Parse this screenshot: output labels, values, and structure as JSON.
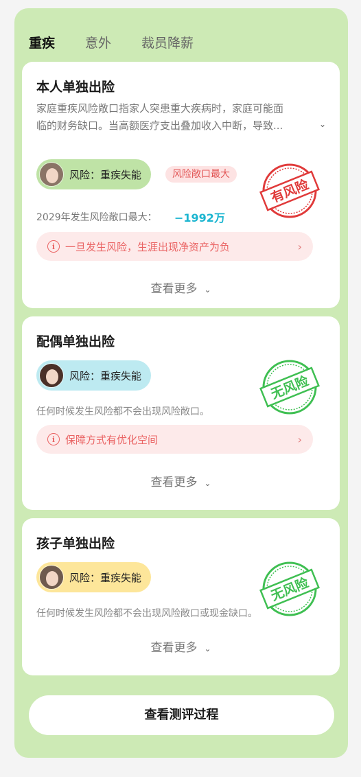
{
  "tabs": [
    {
      "label": "重疾",
      "active": true
    },
    {
      "label": "意外",
      "active": false
    },
    {
      "label": "裁员降薪",
      "active": false
    }
  ],
  "cards": [
    {
      "title": "本人单独出险",
      "description_line1": "家庭重疾风险敞口指家人突患重大疾病时，家庭可能面",
      "description_line2": "临的财务缺口。当高额医疗支出叠加收入中断，导致...",
      "risk_label": "风险：重疾失能",
      "risk_pill_color": "#bfe3a6",
      "tag": "风险敞口最大",
      "stat_text": "2029年发生风险敞口最大：",
      "stat_value": "−1992万",
      "note": "一旦发生风险，生涯出现净资产为负",
      "more": "查看更多",
      "stamp_text": "有风险",
      "stamp_color": "#e03a3a"
    },
    {
      "title": "配偶单独出险",
      "risk_label": "风险：重疾失能",
      "risk_pill_color": "#bdeaf1",
      "line": "任何时候发生风险都不会出现风险敞口。",
      "note": "保障方式有优化空间",
      "more": "查看更多",
      "stamp_text": "无风险",
      "stamp_color": "#3fbf52"
    },
    {
      "title": "孩子单独出险",
      "risk_label": "风险：重疾失能",
      "risk_pill_color": "#fde69a",
      "line": "任何时候发生风险都不会出现风险敞口或现金缺口。",
      "more": "查看更多",
      "stamp_text": "无风险",
      "stamp_color": "#3fbf52"
    }
  ],
  "bottom_button": "查看测评过程",
  "icons": {
    "info": "info-circle-icon",
    "chevron_down": "chevron-down-icon",
    "chevron_right": "chevron-right-icon"
  }
}
